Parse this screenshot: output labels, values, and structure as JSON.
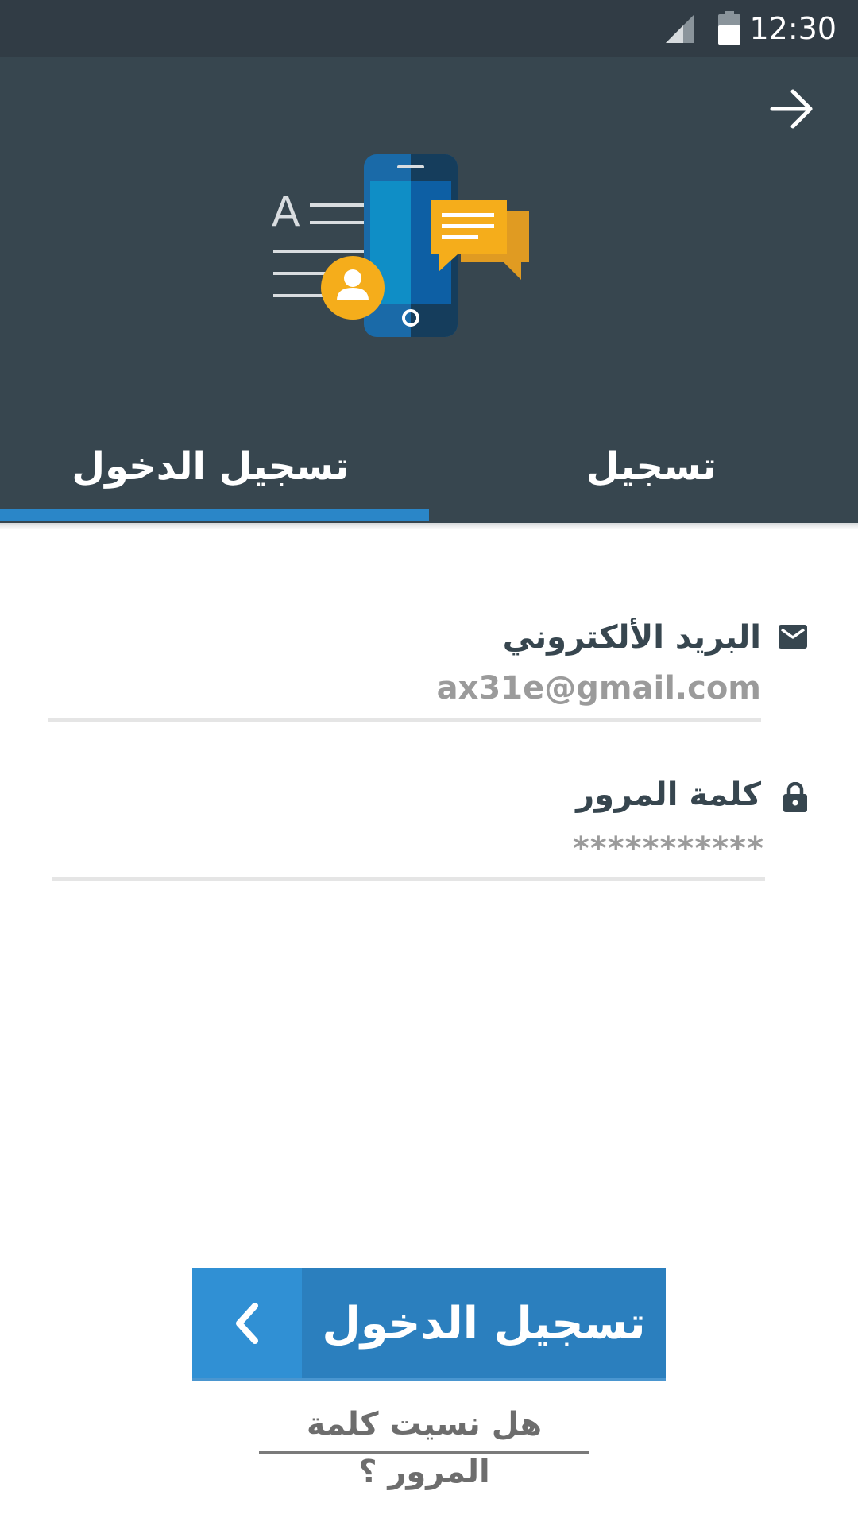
{
  "status_bar": {
    "time": "12:30"
  },
  "tabs": [
    {
      "label": "تسجيل الدخول",
      "selected": true
    },
    {
      "label": "تسجيل",
      "selected": false
    }
  ],
  "form": {
    "email": {
      "label": "البريد الألكتروني",
      "value": "ax31e@gmail.com",
      "icon": "mail-icon"
    },
    "password": {
      "label": "كلمة المرور",
      "value": "***********",
      "icon": "lock-icon"
    }
  },
  "login_button": {
    "label": "تسجيل الدخول",
    "icon": "chevron-left-icon"
  },
  "forgot_password": {
    "label": "هل نسيت كلمة المرور ؟"
  },
  "colors": {
    "header": "#37464f",
    "status_bar": "#313c45",
    "accent": "#2a86c8",
    "button": "#2b7fbe",
    "button_icon_area": "#3090d4"
  }
}
